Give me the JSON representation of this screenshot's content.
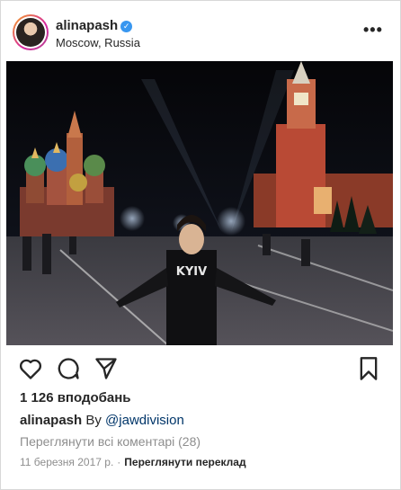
{
  "post": {
    "username": "alinapash",
    "verified_icon": "verified-badge-icon",
    "location": "Moscow, Russia",
    "more_icon": "more-options-icon",
    "image_description_icon": "photo",
    "likes_text": "1 126 вподобань",
    "caption_user": "alinapash",
    "caption_text": " By ",
    "caption_mention": "@jawdivision",
    "view_comments": "Переглянути всі коментарі (28)",
    "date": "11 березня 2017 р.",
    "separator": "·",
    "translate": "Переглянути переклад"
  },
  "photo": {
    "shirt_text": "KYIV"
  },
  "colors": {
    "accent": "#3897f0",
    "text": "#262626",
    "muted": "#8e8e8e",
    "mention": "#003569"
  }
}
